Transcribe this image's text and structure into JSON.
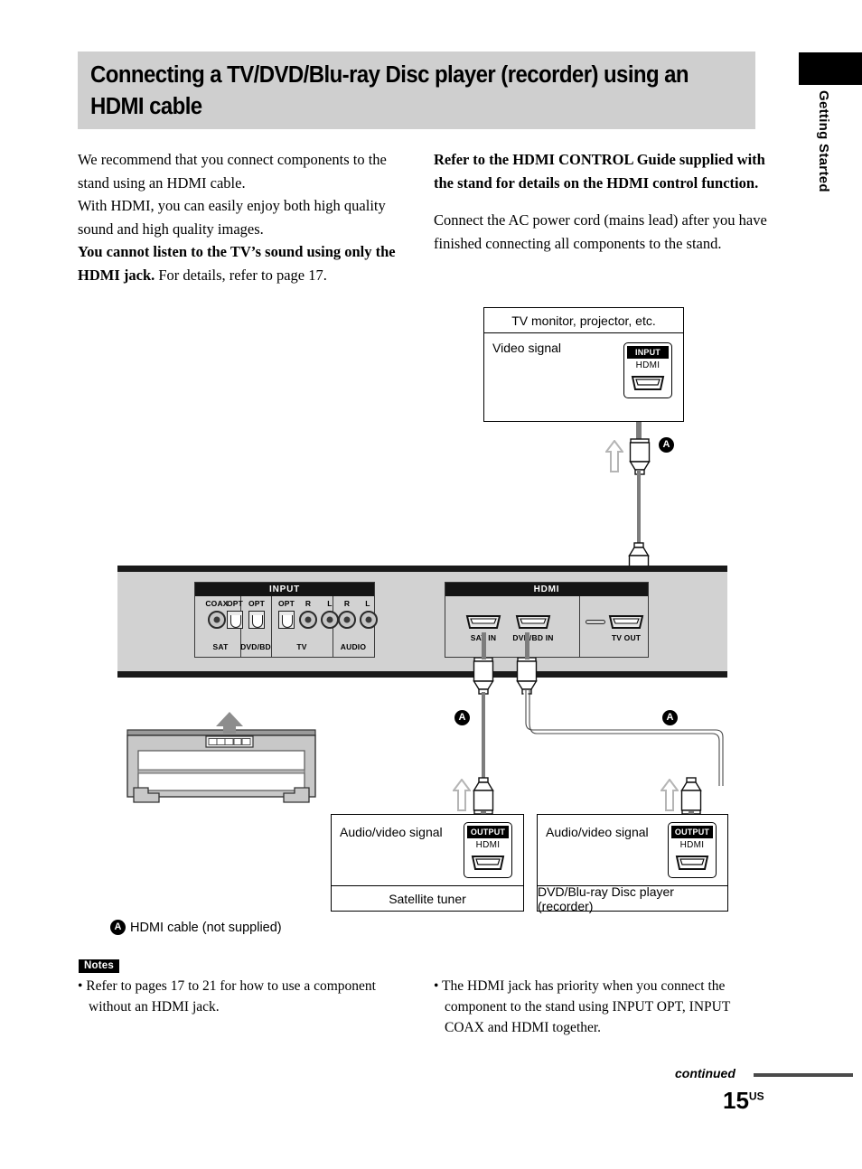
{
  "side_tab": {
    "label": "Getting Started"
  },
  "header": {
    "title": "Connecting a TV/DVD/Blu-ray Disc player (recorder) using an HDMI cable"
  },
  "intro": {
    "left": {
      "line1": "We recommend that you connect components to the stand using an HDMI cable.",
      "line2": "With HDMI, you can easily enjoy both high quality sound and high quality images.",
      "bold_lead": "You cannot listen to the TV’s sound using only the HDMI jack.",
      "tail": " For details, refer to page 17."
    },
    "right": {
      "bold_para": "Refer to the HDMI CONTROL Guide supplied with the stand for details on the HDMI control function.",
      "para": "Connect the AC power cord (mains lead) after you have finished connecting all components to the stand."
    }
  },
  "diagram": {
    "tv_box": {
      "title": "TV monitor, projector, etc.",
      "signal_label": "Video signal",
      "jack": {
        "bar": "INPUT",
        "type": "HDMI"
      }
    },
    "rear_panel": {
      "input_group": {
        "header": "INPUT",
        "jacks": [
          {
            "top_label": "COAX",
            "kind": "rca"
          },
          {
            "top_label": "OPT",
            "kind": "optical"
          },
          {
            "top_label": "OPT",
            "kind": "optical"
          },
          {
            "top_label": "OPT",
            "kind": "optical"
          },
          {
            "top_label": "R",
            "kind": "rca"
          },
          {
            "top_label": "L",
            "kind": "rca"
          },
          {
            "top_label": "R",
            "kind": "rca"
          },
          {
            "top_label": "L",
            "kind": "rca"
          }
        ],
        "bottom_labels": [
          "SAT",
          "DVD/BD",
          "TV",
          "AUDIO"
        ]
      },
      "hdmi_group": {
        "header": "HDMI",
        "jacks": [
          {
            "label": "SAT IN"
          },
          {
            "label": "DVD/BD IN"
          },
          {
            "label": "TV OUT"
          }
        ]
      }
    },
    "components": [
      {
        "signal_label": "Audio/video signal",
        "name": "Satellite tuner",
        "jack": {
          "bar": "OUTPUT",
          "type": "HDMI"
        }
      },
      {
        "signal_label": "Audio/video signal",
        "name": "DVD/Blu-ray Disc player (recorder)",
        "jack": {
          "bar": "OUTPUT",
          "type": "HDMI"
        }
      }
    ],
    "cable_markers": [
      "A",
      "A",
      "A"
    ]
  },
  "legend": {
    "marker": "A",
    "text": "HDMI cable (not supplied)"
  },
  "notes": {
    "heading": "Notes",
    "items": [
      "Refer to pages 17 to 21 for how to use a component without an HDMI jack.",
      "The HDMI jack has priority when you connect the component to the stand using INPUT OPT, INPUT COAX and HDMI together."
    ]
  },
  "footer": {
    "continued": "continued",
    "page_number": "15",
    "page_suffix": "US"
  },
  "colors": {
    "title_band": "#cfcfcf",
    "panel": "#d2d2d2",
    "panel_bar": "#1a1a1a",
    "cable": "#7d7d7d"
  }
}
